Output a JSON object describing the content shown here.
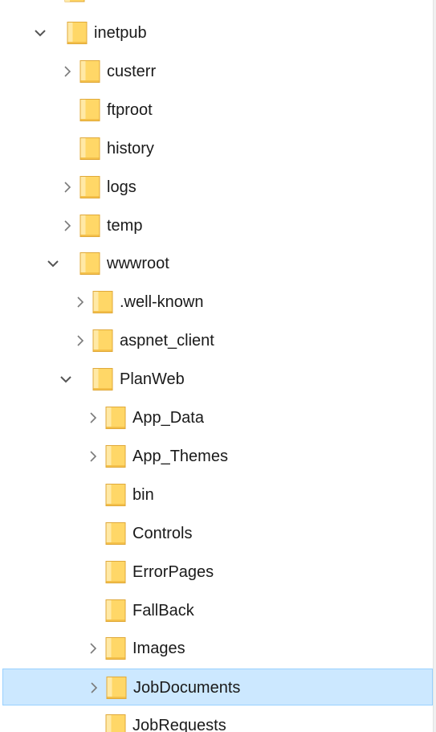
{
  "tree": {
    "items": [
      {
        "label": "inetpub",
        "depth": 0,
        "chevron": "expanded"
      },
      {
        "label": "custerr",
        "depth": 1,
        "chevron": "collapsed"
      },
      {
        "label": "ftproot",
        "depth": 1,
        "chevron": "none"
      },
      {
        "label": "history",
        "depth": 1,
        "chevron": "none"
      },
      {
        "label": "logs",
        "depth": 1,
        "chevron": "collapsed"
      },
      {
        "label": "temp",
        "depth": 1,
        "chevron": "collapsed"
      },
      {
        "label": "wwwroot",
        "depth": 1,
        "chevron": "expanded"
      },
      {
        "label": ".well-known",
        "depth": 2,
        "chevron": "collapsed"
      },
      {
        "label": "aspnet_client",
        "depth": 2,
        "chevron": "collapsed"
      },
      {
        "label": "PlanWeb",
        "depth": 2,
        "chevron": "expanded"
      },
      {
        "label": "App_Data",
        "depth": 3,
        "chevron": "collapsed"
      },
      {
        "label": "App_Themes",
        "depth": 3,
        "chevron": "collapsed"
      },
      {
        "label": "bin",
        "depth": 3,
        "chevron": "none"
      },
      {
        "label": "Controls",
        "depth": 3,
        "chevron": "none"
      },
      {
        "label": "ErrorPages",
        "depth": 3,
        "chevron": "none"
      },
      {
        "label": "FallBack",
        "depth": 3,
        "chevron": "none"
      },
      {
        "label": "Images",
        "depth": 3,
        "chevron": "collapsed"
      },
      {
        "label": "JobDocuments",
        "depth": 3,
        "chevron": "collapsed",
        "selected": true
      },
      {
        "label": "JobRequests",
        "depth": 3,
        "chevron": "none"
      }
    ]
  },
  "colors": {
    "selection_bg": "#cce8ff",
    "selection_border": "#99d1ff",
    "folder_fill": "#ffd767",
    "folder_light": "#ffe9a6",
    "folder_edge": "#e0a93a",
    "chevron": "#7a7a7a"
  },
  "icons": {
    "folder": "folder-icon",
    "expanded": "chevron-down-icon",
    "collapsed": "chevron-right-icon"
  }
}
